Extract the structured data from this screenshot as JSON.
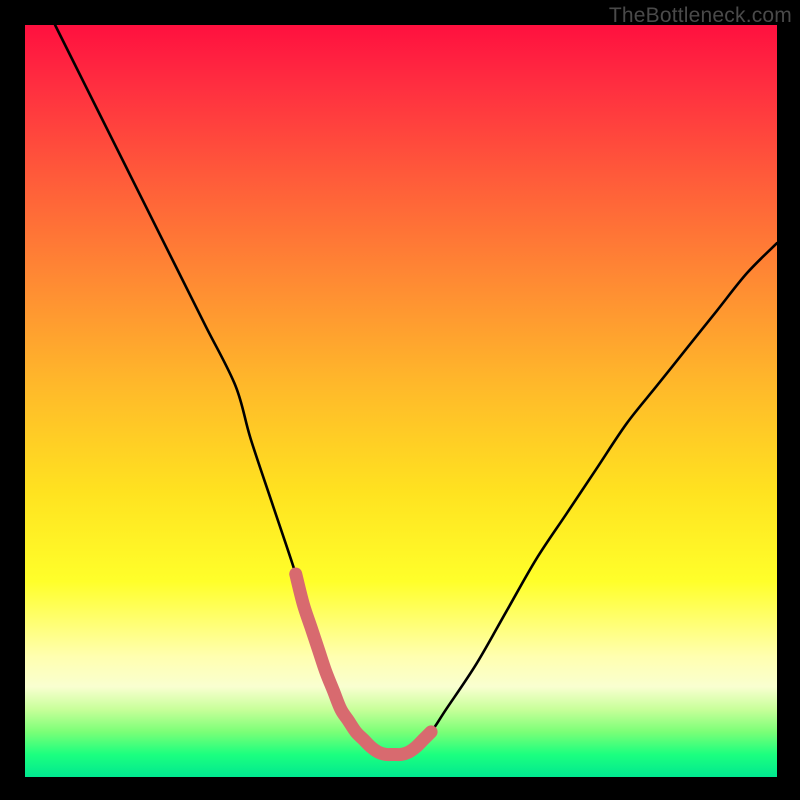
{
  "watermark": "TheBottleneck.com",
  "chart_data": {
    "type": "line",
    "title": "",
    "xlabel": "",
    "ylabel": "",
    "xlim": [
      0,
      100
    ],
    "ylim": [
      0,
      100
    ],
    "series": [
      {
        "name": "bottleneck-curve",
        "stroke": "#000000",
        "x": [
          4,
          8,
          12,
          16,
          20,
          24,
          28,
          30,
          33,
          36,
          38,
          40,
          42,
          44,
          46,
          48,
          50,
          52,
          54,
          56,
          60,
          64,
          68,
          72,
          76,
          80,
          84,
          88,
          92,
          96,
          100
        ],
        "values": [
          100,
          92,
          84,
          76,
          68,
          60,
          52,
          45,
          36,
          27,
          20,
          14,
          9,
          6,
          4,
          3,
          3,
          4,
          6,
          9,
          15,
          22,
          29,
          35,
          41,
          47,
          52,
          57,
          62,
          67,
          71
        ]
      },
      {
        "name": "valley-highlight",
        "stroke": "#d86a6f",
        "x": [
          36,
          37,
          38,
          39,
          40,
          41,
          42,
          43,
          44,
          45,
          46,
          47,
          48,
          49,
          50,
          51,
          52,
          53,
          54
        ],
        "values": [
          27,
          23,
          20,
          17,
          14,
          11.5,
          9,
          7.5,
          6,
          5,
          4,
          3.3,
          3,
          3,
          3,
          3.3,
          4,
          5,
          6
        ]
      }
    ],
    "gradient_stops": [
      {
        "pos": 0,
        "color": "#ff103f"
      },
      {
        "pos": 20,
        "color": "#ff5a3a"
      },
      {
        "pos": 48,
        "color": "#ffb92a"
      },
      {
        "pos": 74,
        "color": "#ffff2a"
      },
      {
        "pos": 88,
        "color": "#f9ffd0"
      },
      {
        "pos": 100,
        "color": "#00e890"
      }
    ]
  }
}
